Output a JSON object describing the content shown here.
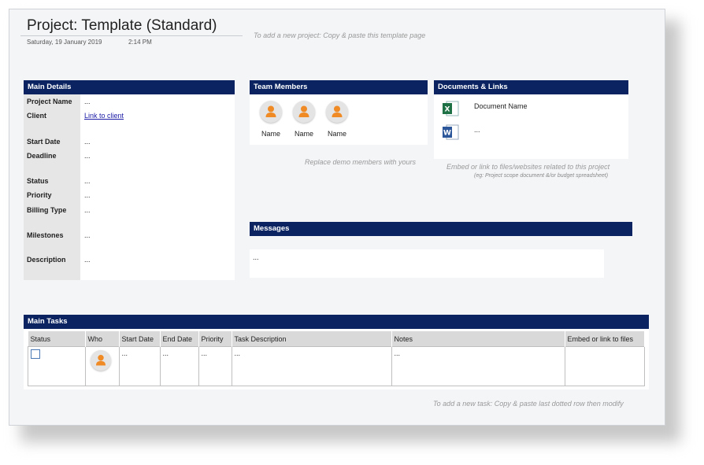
{
  "page": {
    "title": "Project: Template (Standard)",
    "date": "Saturday, 19 January 2019",
    "time": "2:14 PM",
    "new_project_hint": "To add a new project: Copy & paste this template page"
  },
  "main_details": {
    "header": "Main Details",
    "fields": [
      {
        "label": "Project Name",
        "value": "..."
      },
      {
        "label": "Client",
        "value": "Link to client"
      },
      {
        "label": "Start Date",
        "value": "..."
      },
      {
        "label": "Deadline",
        "value": "..."
      },
      {
        "label": "Status",
        "value": "..."
      },
      {
        "label": "Priority",
        "value": "..."
      },
      {
        "label": "Billing Type",
        "value": "..."
      },
      {
        "label": "Milestones",
        "value": "..."
      },
      {
        "label": "Description",
        "value": "..."
      }
    ]
  },
  "team_members": {
    "header": "Team Members",
    "members": [
      {
        "name": "Name"
      },
      {
        "name": "Name"
      },
      {
        "name": "Name"
      }
    ],
    "hint": "Replace demo members with yours"
  },
  "documents": {
    "header": "Documents & Links",
    "items": [
      {
        "icon": "excel-icon",
        "label": "Document Name"
      },
      {
        "icon": "word-icon",
        "label": "..."
      }
    ],
    "hint": "Embed or link to files/websites related to this project",
    "subhint": "(eg: Project scope document &/or budget spreadsheet)"
  },
  "messages": {
    "header": "Messages",
    "body": "..."
  },
  "tasks": {
    "header": "Main Tasks",
    "columns": [
      "Status",
      "Who",
      "Start Date",
      "End Date",
      "Priority",
      "Task Description",
      "Notes",
      "Embed or link to files"
    ],
    "row": {
      "start": "...",
      "end": "...",
      "priority": "...",
      "description": "...",
      "notes": "..."
    },
    "hint": "To add a new task: Copy & paste last dotted row then modify"
  },
  "colors": {
    "header_bg": "#0b2461",
    "avatar_orange": "#f08a24",
    "link": "#1a1aa6"
  }
}
